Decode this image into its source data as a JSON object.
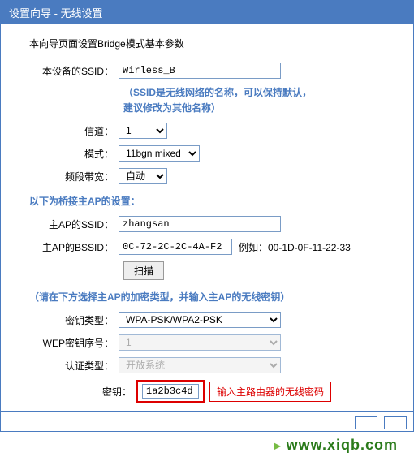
{
  "title": "设置向导 - 无线设置",
  "intro": "本向导页面设置Bridge模式基本参数",
  "device": {
    "ssid_label": "本设备的SSID：",
    "ssid_value": "Wirless_B",
    "hint_line1": "（SSID是无线网络的名称，可以保持默认，",
    "hint_line2": "建议修改为其他名称）",
    "channel_label": "信道：",
    "channel_value": "1",
    "mode_label": "模式：",
    "mode_value": "11bgn mixed",
    "bandwidth_label": "频段带宽：",
    "bandwidth_value": "自动"
  },
  "bridge": {
    "section": "以下为桥接主AP的设置：",
    "ssid_label": "主AP的SSID：",
    "ssid_value": "zhangsan",
    "bssid_label": "主AP的BSSID：",
    "bssid_value": "0C-72-2C-2C-4A-F2",
    "bssid_example": "例如：00-1D-0F-11-22-33",
    "scan_btn": "扫描",
    "security_note": "（请在下方选择主AP的加密类型，并输入主AP的无线密钥）",
    "keytype_label": "密钥类型：",
    "keytype_value": "WPA-PSK/WPA2-PSK",
    "wep_label": "WEP密钥序号：",
    "wep_value": "1",
    "auth_label": "认证类型：",
    "auth_value": "开放系统",
    "key_label": "密钥：",
    "key_value": "1a2b3c4d",
    "key_callout": "输入主路由器的无线密码"
  },
  "site": "www.xiqb.com"
}
